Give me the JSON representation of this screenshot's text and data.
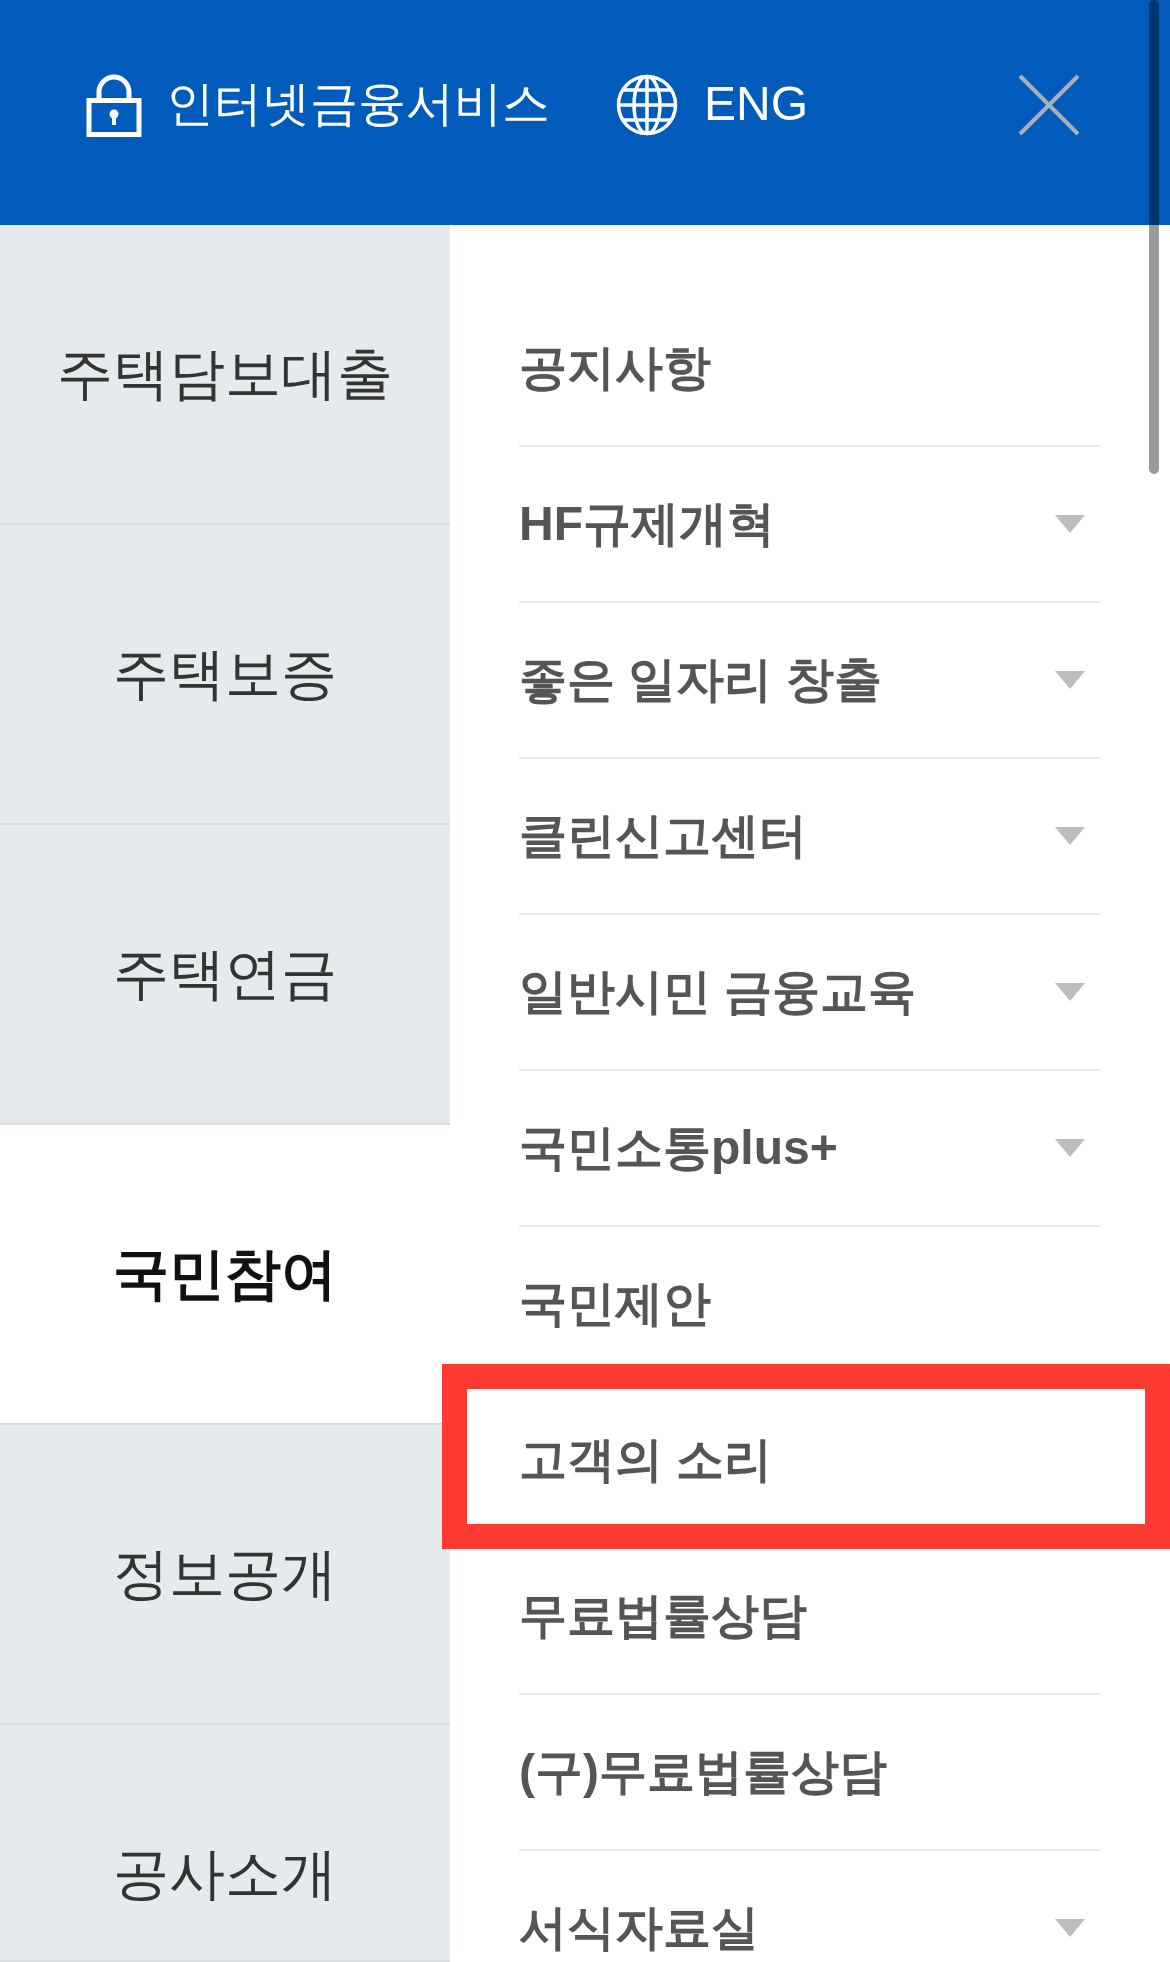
{
  "header": {
    "internet_banking": {
      "label": "인터넷금융서비스"
    },
    "language": {
      "label": "ENG"
    }
  },
  "categories": [
    {
      "label": "주택담보대출",
      "selected": false
    },
    {
      "label": "주택보증",
      "selected": false
    },
    {
      "label": "주택연금",
      "selected": false
    },
    {
      "label": "국민참여",
      "selected": true
    },
    {
      "label": "정보공개",
      "selected": false
    },
    {
      "label": "공사소개",
      "selected": false
    }
  ],
  "menu": {
    "items": [
      {
        "label": "공지사항",
        "has_submenu": false,
        "highlighted": false
      },
      {
        "label": "HF규제개혁",
        "has_submenu": true,
        "highlighted": false
      },
      {
        "label": "좋은 일자리 창출",
        "has_submenu": true,
        "highlighted": false
      },
      {
        "label": "클린신고센터",
        "has_submenu": true,
        "highlighted": false
      },
      {
        "label": "일반시민 금융교육",
        "has_submenu": true,
        "highlighted": false
      },
      {
        "label": "국민소통plus+",
        "has_submenu": true,
        "highlighted": false
      },
      {
        "label": "국민제안",
        "has_submenu": false,
        "highlighted": false
      },
      {
        "label": "고객의 소리",
        "has_submenu": false,
        "highlighted": true
      },
      {
        "label": "무료법률상담",
        "has_submenu": false,
        "highlighted": false
      },
      {
        "label": "(구)무료법률상담",
        "has_submenu": false,
        "highlighted": false
      },
      {
        "label": "서식자료실",
        "has_submenu": true,
        "highlighted": false
      }
    ]
  }
}
